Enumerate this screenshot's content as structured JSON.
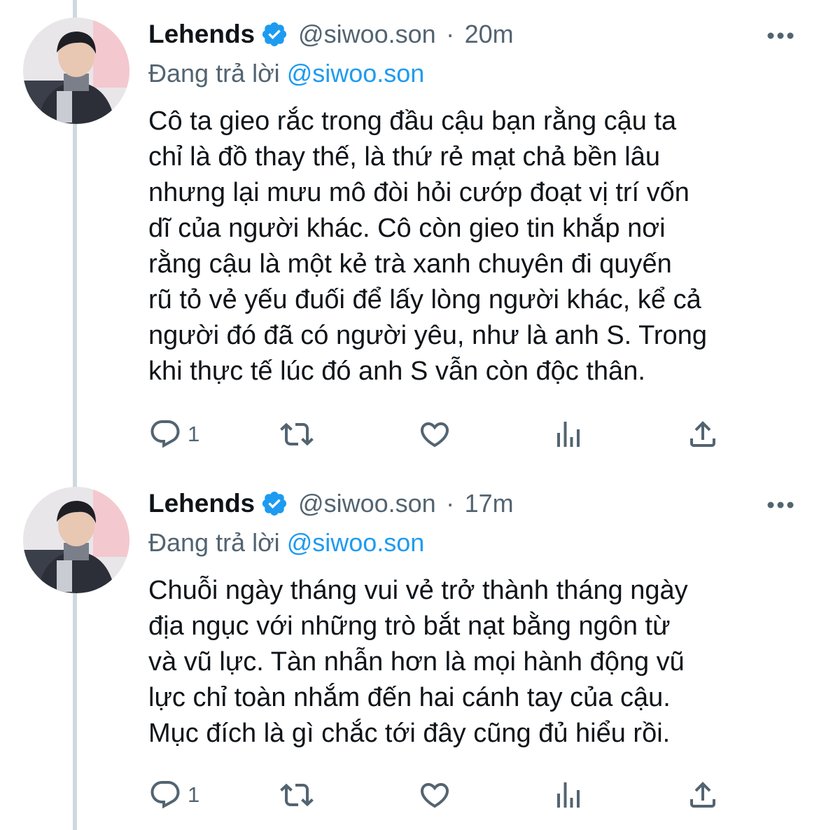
{
  "tweets": [
    {
      "display_name": "Lehends",
      "handle": "@siwoo.son",
      "separator": "·",
      "time": "20m",
      "replying_prefix": "Đang trả lời ",
      "replying_to": "@siwoo.son",
      "text": "Cô ta gieo rắc trong đầu cậu bạn rằng cậu ta\nchỉ là đồ thay thế, là thứ rẻ mạt chả bền lâu\nnhưng lại mưu mô đòi hỏi cướp đoạt vị trí vốn\ndĩ của người khác. Cô còn gieo tin khắp nơi\nrằng cậu là một kẻ trà xanh chuyên đi quyến\nrũ tỏ vẻ yếu đuối để lấy lòng người khác, kể cả\nngười đó đã có người yêu, như là anh S. Trong\nkhi thực tế lúc đó anh S vẫn còn độc thân.",
      "reply_count": "1",
      "icons": [
        "reply-icon",
        "retweet-icon",
        "like-icon",
        "analytics-icon",
        "share-icon",
        "more-icon",
        "verified-badge-icon"
      ]
    },
    {
      "display_name": "Lehends",
      "handle": "@siwoo.son",
      "separator": "·",
      "time": "17m",
      "replying_prefix": "Đang trả lời ",
      "replying_to": "@siwoo.son",
      "text": "Chuỗi ngày tháng vui vẻ trở thành tháng ngày\nđịa ngục với những trò bắt nạt bằng ngôn từ\nvà vũ lực. Tàn nhẫn hơn là mọi hành động vũ\nlực chỉ toàn nhắm đến hai cánh tay của cậu.\nMục đích là gì chắc tới đây cũng đủ hiểu rồi.",
      "reply_count": "1",
      "icons": [
        "reply-icon",
        "retweet-icon",
        "like-icon",
        "analytics-icon",
        "share-icon",
        "more-icon",
        "verified-badge-icon"
      ]
    }
  ],
  "colors": {
    "text": "#0f1419",
    "secondary": "#536471",
    "accent": "#1d9bf0",
    "thread_line": "#cfd9de"
  }
}
